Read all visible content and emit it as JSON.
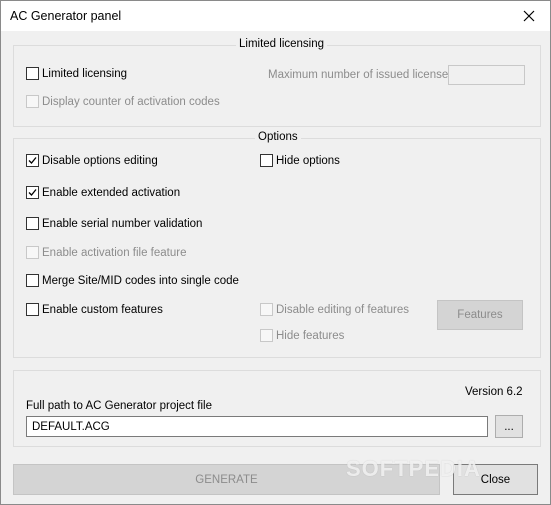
{
  "window": {
    "title": "AC Generator panel",
    "close_icon": "close-icon"
  },
  "limited": {
    "title": "Limited licensing",
    "limited_licensing": {
      "label": "Limited licensing",
      "checked": false
    },
    "max_licenses_label": "Maximum number of issued licenses:",
    "max_licenses_value": "",
    "display_counter": {
      "label": "Display counter of activation codes",
      "checked": false
    }
  },
  "options": {
    "title": "Options",
    "disable_options_editing": {
      "label": "Disable options editing",
      "checked": true
    },
    "hide_options": {
      "label": "Hide options",
      "checked": false
    },
    "enable_extended_activation": {
      "label": "Enable extended activation",
      "checked": true
    },
    "enable_serial_validation": {
      "label": "Enable serial number validation",
      "checked": false
    },
    "enable_activation_file": {
      "label": "Enable activation file feature",
      "checked": false
    },
    "merge_codes": {
      "label": "Merge Site/MID codes into single code",
      "checked": false
    },
    "enable_custom_features": {
      "label": "Enable custom features",
      "checked": false
    },
    "disable_editing_features": {
      "label": "Disable editing of features",
      "checked": false
    },
    "hide_features": {
      "label": "Hide features",
      "checked": false
    },
    "features_button": "Features"
  },
  "project": {
    "version": "Version 6.2",
    "path_label": "Full path to AC Generator project file",
    "path_value": "DEFAULT.ACG",
    "browse_label": "..."
  },
  "actions": {
    "generate": "GENERATE",
    "close": "Close"
  },
  "watermark": "SOFTPEDIA"
}
